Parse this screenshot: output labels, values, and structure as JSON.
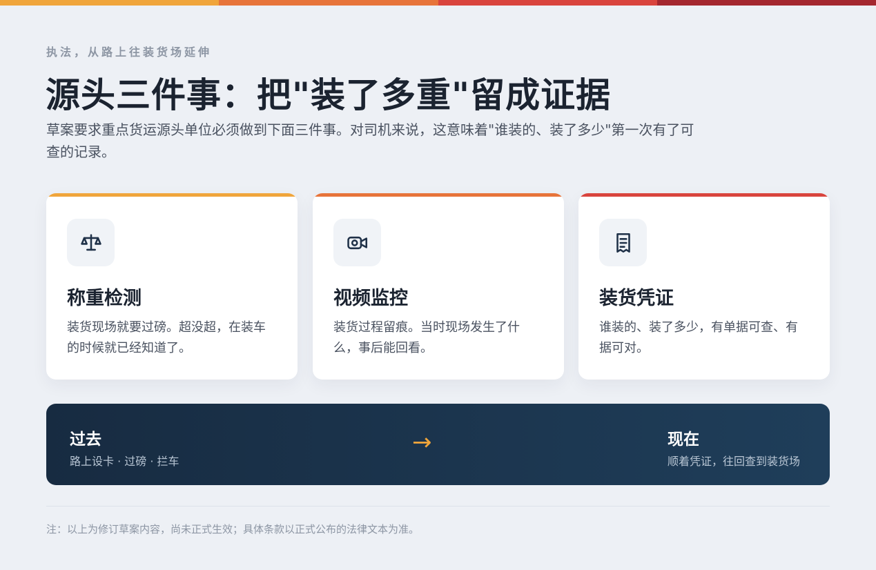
{
  "colors": {
    "bar": [
      "#f0a53b",
      "#e7743a",
      "#d9443d",
      "#a4272f"
    ],
    "card_accents": [
      "#f0a53b",
      "#e7743a",
      "#d9443d"
    ]
  },
  "kicker": "执法，从路上往装货场延伸",
  "title": "源头三件事：把\"装了多重\"留成证据",
  "description": "草案要求重点货运源头单位必须做到下面三件事。对司机来说，这意味着\"谁装的、装了多少\"第一次有了可查的记录。",
  "cards": [
    {
      "icon": "scale-icon",
      "title": "称重检测",
      "text": "装货现场就要过磅。超没超，在装车的时候就已经知道了。"
    },
    {
      "icon": "video-camera-icon",
      "title": "视频监控",
      "text": "装货过程留痕。当时现场发生了什么，事后能回看。"
    },
    {
      "icon": "receipt-icon",
      "title": "装货凭证",
      "text": "谁装的、装了多少，有单据可查、有据可对。"
    }
  ],
  "comparison": {
    "past_label": "过去",
    "past_sub": "路上设卡 · 过磅 · 拦车",
    "arrow": "→",
    "now_label": "现在",
    "now_sub": "顺着凭证，往回查到装货场"
  },
  "note": "注：以上为修订草案内容，尚未正式生效；具体条款以正式公布的法律文本为准。"
}
